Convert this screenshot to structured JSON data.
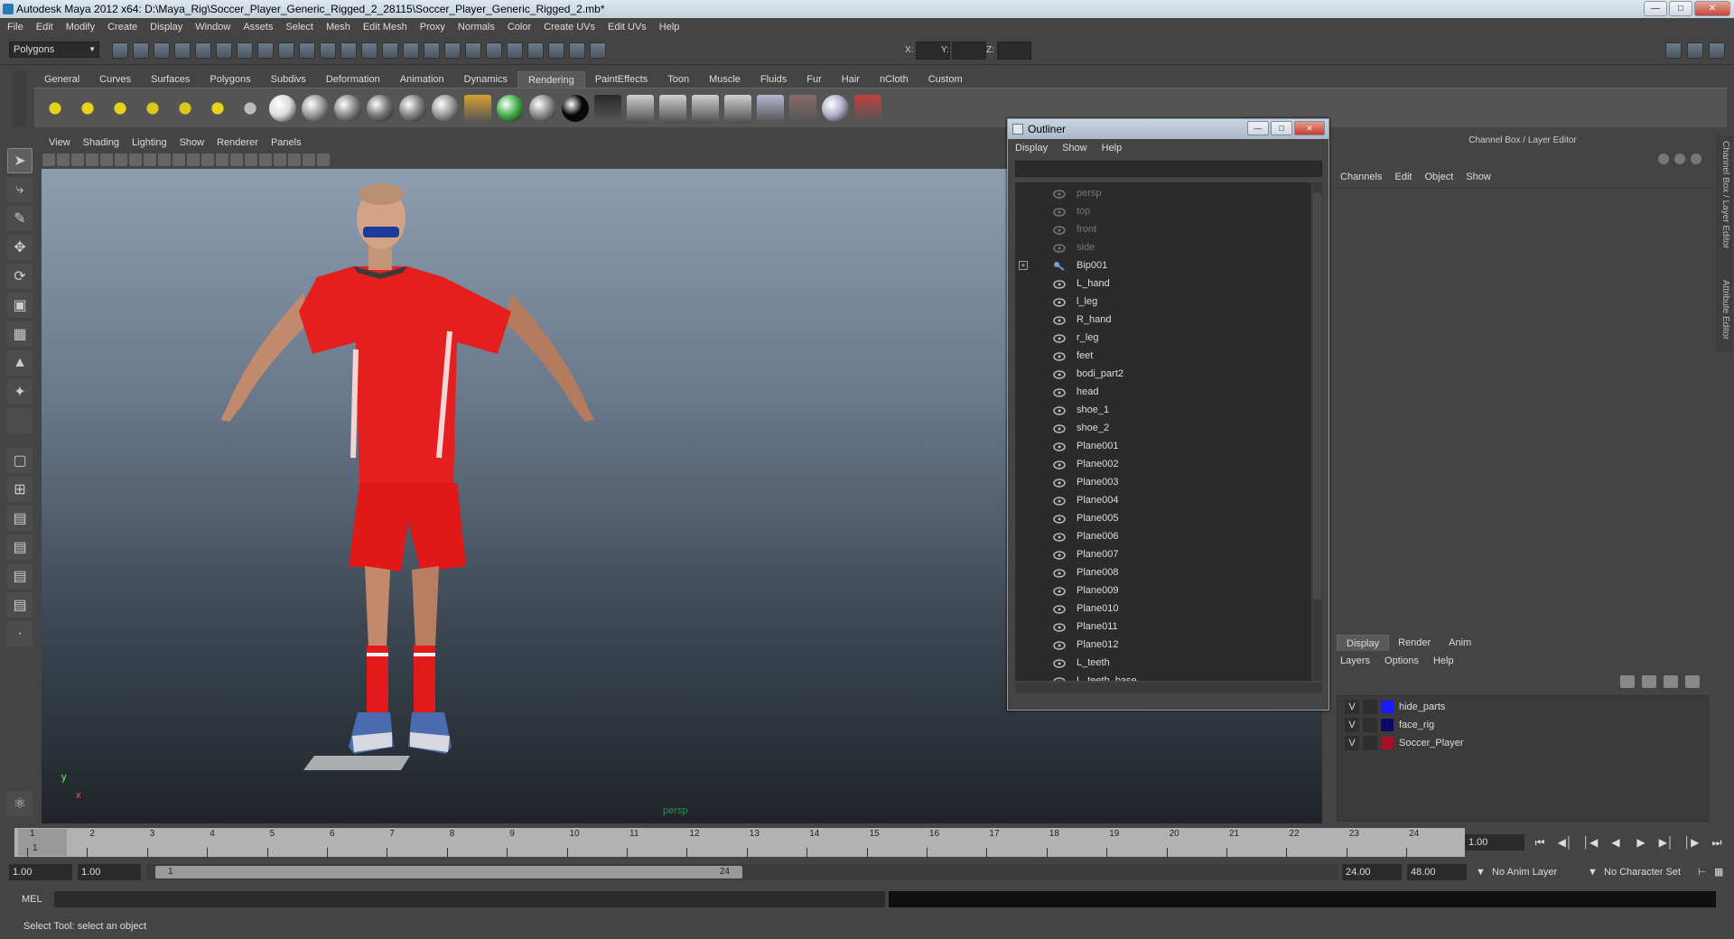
{
  "window": {
    "title": "Autodesk Maya 2012 x64: D:\\Maya_Rig\\Soccer_Player_Generic_Rigged_2_28115\\Soccer_Player_Generic_Rigged_2.mb*"
  },
  "menubar": [
    "File",
    "Edit",
    "Modify",
    "Create",
    "Display",
    "Window",
    "Assets",
    "Select",
    "Mesh",
    "Edit Mesh",
    "Proxy",
    "Normals",
    "Color",
    "Create UVs",
    "Edit UVs",
    "Help"
  ],
  "status_line": {
    "mode": "Polygons",
    "x_label": "X:",
    "y_label": "Y:",
    "z_label": "Z:"
  },
  "shelf": {
    "tabs": [
      "General",
      "Curves",
      "Surfaces",
      "Polygons",
      "Subdivs",
      "Deformation",
      "Animation",
      "Dynamics",
      "Rendering",
      "PaintEffects",
      "Toon",
      "Muscle",
      "Fluids",
      "Fur",
      "Hair",
      "nCloth",
      "Custom"
    ],
    "active_tab": "Rendering",
    "icons": [
      {
        "name": "ambient-light-icon",
        "color": "#e8d21a"
      },
      {
        "name": "directional-light-icon",
        "color": "#e8d21a"
      },
      {
        "name": "point-light-icon",
        "color": "#e8d21a"
      },
      {
        "name": "spot-light-icon",
        "color": "#d8c81a"
      },
      {
        "name": "area-light-icon",
        "color": "#d8c81a"
      },
      {
        "name": "volume-light-icon",
        "color": "#e8d21a"
      },
      {
        "name": "light-linking-icon",
        "color": "#bbbbbb"
      },
      {
        "name": "hypershade-sphere-icon",
        "color": "#dddddd"
      },
      {
        "name": "lambert-sphere-icon",
        "color": "#9a9a9a"
      },
      {
        "name": "blinn-sphere-icon",
        "color": "#8a8a8a"
      },
      {
        "name": "phong-sphere-icon",
        "color": "#7a7a7a"
      },
      {
        "name": "phonge-sphere-icon",
        "color": "#858585"
      },
      {
        "name": "anisotropic-sphere-icon",
        "color": "#9a9a9a"
      },
      {
        "name": "ramp-shader-icon",
        "color": "#d6a030"
      },
      {
        "name": "rainbow-sphere-icon",
        "color": "#46b24a"
      },
      {
        "name": "gray-sphere-icon",
        "color": "#8c8c8c"
      },
      {
        "name": "black-sphere-icon",
        "color": "#050505"
      },
      {
        "name": "surface-shader-icon",
        "color": "#2a2a2a"
      },
      {
        "name": "render-view-icon",
        "color": "#cfcfcf"
      },
      {
        "name": "render-current-icon",
        "color": "#cfcfcf"
      },
      {
        "name": "ipr-render-icon",
        "color": "#cfcfcf"
      },
      {
        "name": "render-settings-icon",
        "color": "#cfcfcf"
      },
      {
        "name": "hypershade-icon",
        "color": "#b7b7d7"
      },
      {
        "name": "batch-render-icon",
        "color": "#8a6a6a"
      },
      {
        "name": "mental-ray-sphere-icon",
        "color": "#b0b0c8"
      },
      {
        "name": "paint-brush-icon",
        "color": "#c04040"
      }
    ]
  },
  "viewport": {
    "menu": [
      "View",
      "Shading",
      "Lighting",
      "Show",
      "Renderer",
      "Panels"
    ],
    "camera_label": "persp",
    "axis_y": "y",
    "axis_x": "x"
  },
  "outliner": {
    "title": "Outliner",
    "menu": [
      "Display",
      "Show",
      "Help"
    ],
    "items": [
      {
        "label": "persp",
        "kind": "camera"
      },
      {
        "label": "top",
        "kind": "camera"
      },
      {
        "label": "front",
        "kind": "camera"
      },
      {
        "label": "side",
        "kind": "camera"
      },
      {
        "label": "Bip001",
        "kind": "joint",
        "expand": "+"
      },
      {
        "label": "L_hand",
        "kind": "mesh"
      },
      {
        "label": "l_leg",
        "kind": "mesh"
      },
      {
        "label": "R_hand",
        "kind": "mesh"
      },
      {
        "label": "r_leg",
        "kind": "mesh"
      },
      {
        "label": "feet",
        "kind": "mesh"
      },
      {
        "label": "bodi_part2",
        "kind": "mesh"
      },
      {
        "label": "head",
        "kind": "mesh"
      },
      {
        "label": "shoe_1",
        "kind": "mesh"
      },
      {
        "label": "shoe_2",
        "kind": "mesh"
      },
      {
        "label": "Plane001",
        "kind": "mesh"
      },
      {
        "label": "Plane002",
        "kind": "mesh"
      },
      {
        "label": "Plane003",
        "kind": "mesh"
      },
      {
        "label": "Plane004",
        "kind": "mesh"
      },
      {
        "label": "Plane005",
        "kind": "mesh"
      },
      {
        "label": "Plane006",
        "kind": "mesh"
      },
      {
        "label": "Plane007",
        "kind": "mesh"
      },
      {
        "label": "Plane008",
        "kind": "mesh"
      },
      {
        "label": "Plane009",
        "kind": "mesh"
      },
      {
        "label": "Plane010",
        "kind": "mesh"
      },
      {
        "label": "Plane011",
        "kind": "mesh"
      },
      {
        "label": "Plane012",
        "kind": "mesh"
      },
      {
        "label": "L_teeth",
        "kind": "mesh"
      },
      {
        "label": "L_teeth_base",
        "kind": "mesh"
      }
    ]
  },
  "channel_box": {
    "title": "Channel Box / Layer Editor",
    "menu": [
      "Channels",
      "Edit",
      "Object",
      "Show"
    ],
    "side_tabs": [
      "Channel Box / Layer Editor",
      "Attribute Editor"
    ]
  },
  "layer_editor": {
    "tabs": [
      "Display",
      "Render",
      "Anim"
    ],
    "active_tab": "Display",
    "menu": [
      "Layers",
      "Options",
      "Help"
    ],
    "layers": [
      {
        "visible": "V",
        "name": "hide_parts",
        "color": "#1a1aff"
      },
      {
        "visible": "V",
        "name": "face_rig",
        "color": "#0a0a66"
      },
      {
        "visible": "V",
        "name": "Soccer_Player",
        "color": "#a8102a"
      }
    ]
  },
  "time_slider": {
    "frames": [
      "1",
      "2",
      "3",
      "4",
      "5",
      "6",
      "7",
      "8",
      "9",
      "10",
      "11",
      "12",
      "13",
      "14",
      "15",
      "16",
      "17",
      "18",
      "19",
      "20",
      "21",
      "22",
      "23",
      "24"
    ],
    "current_frame": "1",
    "current_time": "1.00"
  },
  "range_slider": {
    "anim_start": "1.00",
    "range_start": "1.00",
    "thumb_start": "1",
    "thumb_end": "24",
    "range_end": "24.00",
    "anim_end": "48.00",
    "anim_layer": "No Anim Layer",
    "character_set": "No Character Set"
  },
  "command_line": {
    "label": "MEL"
  },
  "help_line": {
    "text": "Select Tool: select an object"
  }
}
